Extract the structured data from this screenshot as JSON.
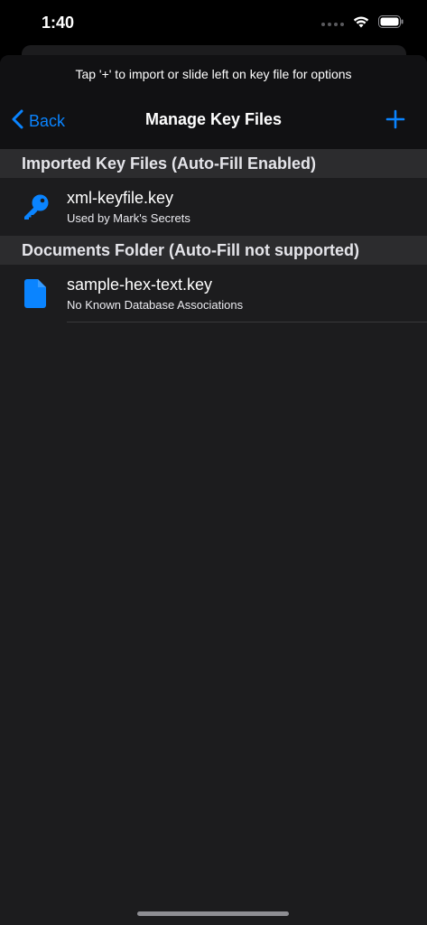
{
  "status": {
    "time": "1:40"
  },
  "nav": {
    "prompt": "Tap '+' to import or slide left on key file for options",
    "back_label": "Back",
    "title": "Manage Key Files"
  },
  "sections": [
    {
      "header": "Imported Key Files (Auto-Fill Enabled)",
      "items": [
        {
          "name": "xml-keyfile.key",
          "subtitle": "Used by Mark's Secrets",
          "icon": "key-icon"
        }
      ]
    },
    {
      "header": "Documents Folder (Auto-Fill not supported)",
      "items": [
        {
          "name": "sample-hex-text.key",
          "subtitle": "No Known Database Associations",
          "icon": "document-icon"
        }
      ]
    }
  ],
  "colors": {
    "accent": "#0a84ff",
    "background": "#1c1c1e",
    "section_header": "#2c2c2e"
  }
}
